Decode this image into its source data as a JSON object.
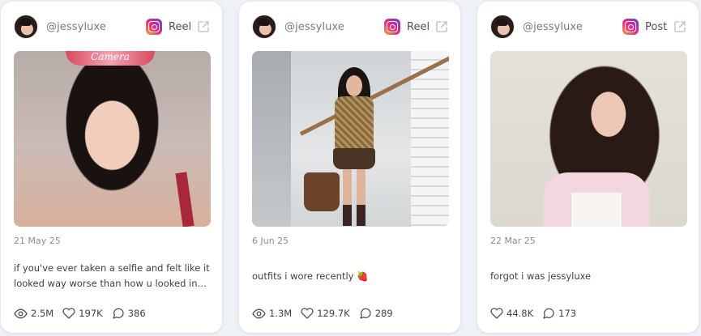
{
  "cards": [
    {
      "handle": "@jessyluxe",
      "platform_icon": "instagram-icon",
      "type": "Reel",
      "date": "21 May 25",
      "caption": "if you've ever taken a selfie and felt like it looked way worse than how u looked in…",
      "media_overlay_text": "Camera",
      "stats": {
        "views": "2.5M",
        "likes": "197K",
        "comments": "386"
      }
    },
    {
      "handle": "@jessyluxe",
      "platform_icon": "instagram-icon",
      "type": "Reel",
      "date": "6 Jun 25",
      "caption": "outfits i wore recently 🍓",
      "stats": {
        "views": "1.3M",
        "likes": "129.7K",
        "comments": "289"
      }
    },
    {
      "handle": "@jessyluxe",
      "platform_icon": "instagram-icon",
      "type": "Post",
      "date": "22 Mar 25",
      "caption": "forgot i was jessyluxe",
      "stats": {
        "likes": "44.8K",
        "comments": "173"
      }
    }
  ],
  "colors": {
    "background": "#eef1f6",
    "card": "#ffffff",
    "muted_text": "#858c98",
    "text": "#3a3f4a"
  }
}
